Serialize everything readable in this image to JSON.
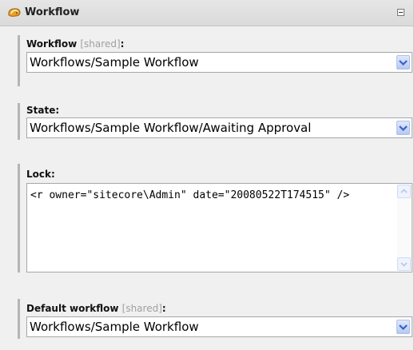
{
  "section": {
    "title": "Workflow"
  },
  "fields": {
    "workflow": {
      "label": "Workflow",
      "shared_tag": "[shared]",
      "colon": ":",
      "value": "Workflows/Sample Workflow"
    },
    "state": {
      "label": "State:",
      "value": "Workflows/Sample Workflow/Awaiting Approval"
    },
    "lock": {
      "label": "Lock:",
      "value": "<r owner=\"sitecore\\Admin\" date=\"20080522T174515\" />"
    },
    "default_workflow": {
      "label": "Default workflow",
      "shared_tag": "[shared]",
      "colon": ":",
      "value": "Workflows/Sample Workflow"
    }
  },
  "icons": {
    "section_icon": "workflow-icon",
    "collapse": "collapse-icon",
    "dropdown": "chevron-down-icon",
    "scroll_up": "scroll-up-icon",
    "scroll_down": "scroll-down-icon"
  },
  "colors": {
    "panel_bg": "#f0f0f0",
    "label_shared": "#a0a0a0",
    "dropdown_arrow": "#3a5fc7",
    "icon_orange": "#e8a328"
  }
}
